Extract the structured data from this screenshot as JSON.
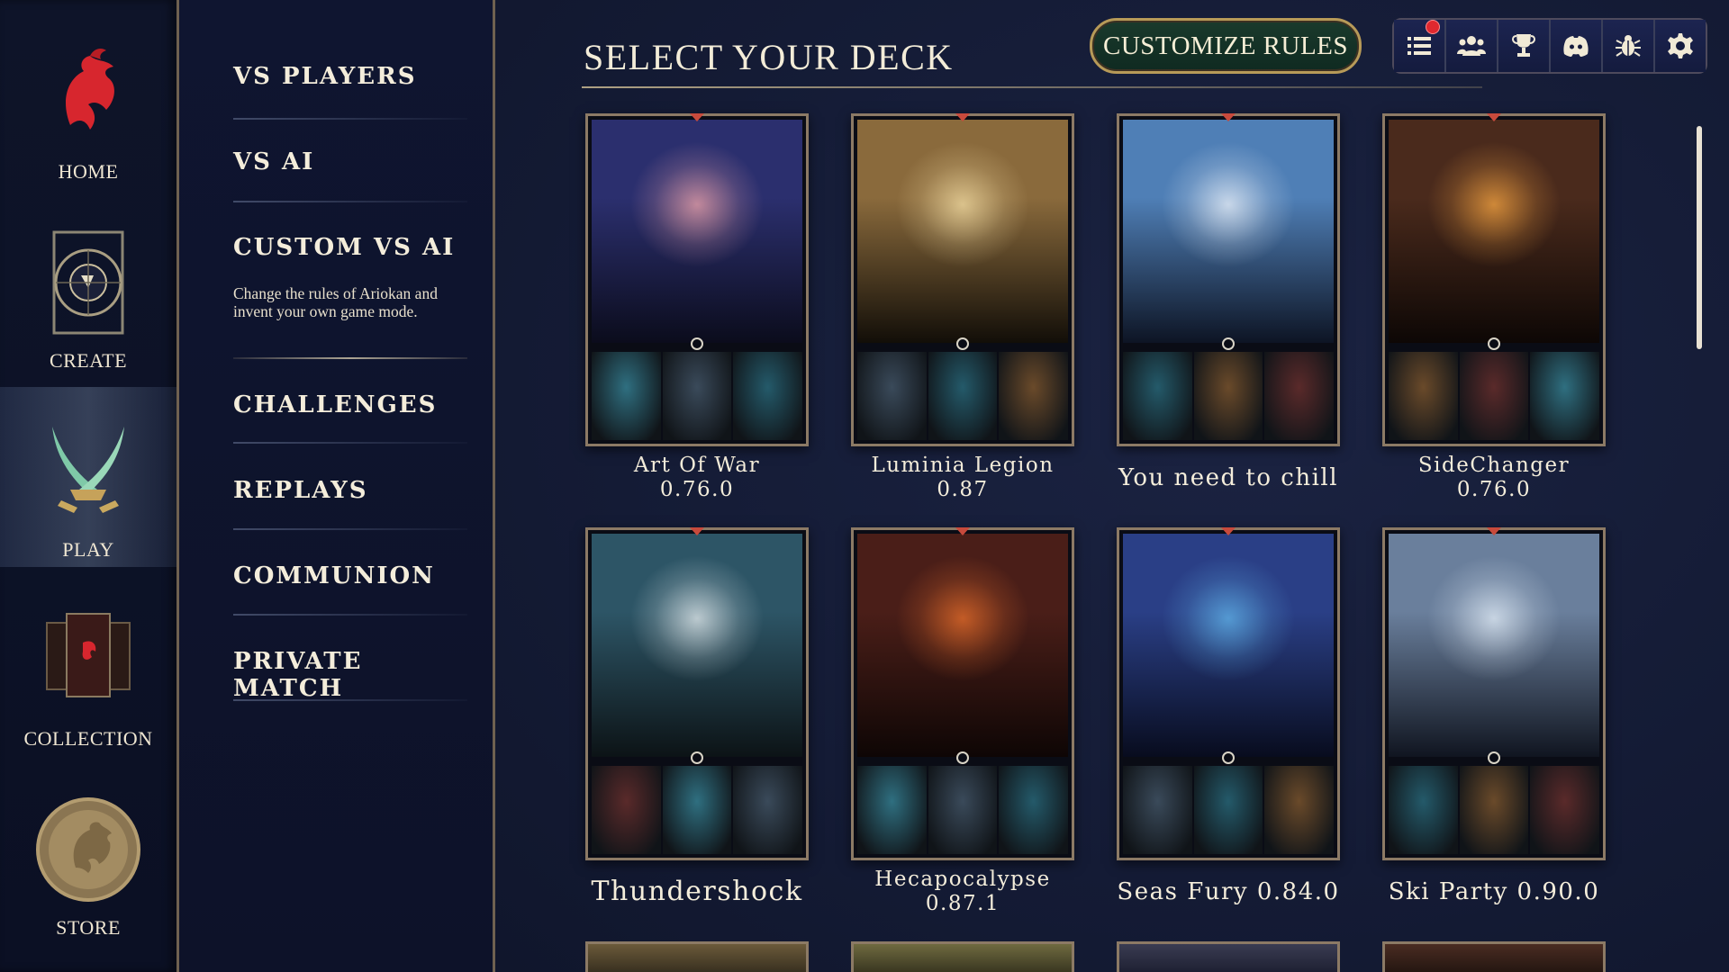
{
  "rail": {
    "items": [
      {
        "label": "HOME",
        "icon": "dragon-logo-icon"
      },
      {
        "label": "CREATE",
        "icon": "rune-circle-icon"
      },
      {
        "label": "PLAY",
        "icon": "crossed-blades-icon",
        "active": true
      },
      {
        "label": "COLLECTION",
        "icon": "card-fan-icon"
      },
      {
        "label": "STORE",
        "icon": "gold-coin-icon"
      }
    ]
  },
  "submenu": {
    "items": [
      {
        "label": "VS PLAYERS"
      },
      {
        "label": "VS AI"
      },
      {
        "label": "CUSTOM VS AI",
        "description": "Change the rules of Ariokan and invent your own game mode."
      },
      {
        "label": "CHALLENGES"
      },
      {
        "label": "REPLAYS"
      },
      {
        "label": "COMMUNION"
      },
      {
        "label": "PRIVATE MATCH"
      }
    ]
  },
  "header": {
    "title": "SELECT YOUR DECK",
    "customize_label": "CUSTOMIZE RULES"
  },
  "toolbar": {
    "buttons": [
      "list-icon",
      "friends-icon",
      "trophy-icon",
      "discord-icon",
      "bug-icon",
      "settings-icon"
    ],
    "notification_on": "list-icon"
  },
  "decks": [
    {
      "name": "Art Of War",
      "version": "0.76.0",
      "art": "raven-queen",
      "colors": {
        "top": "#2b2f6e",
        "bottom": "#0b0c1c",
        "accent": "#e8a0a8"
      }
    },
    {
      "name": "Luminia Legion",
      "version": "0.87",
      "art": "golden-angel",
      "colors": {
        "top": "#8a6a3c",
        "bottom": "#120e08",
        "accent": "#f0d9a0"
      }
    },
    {
      "name": "You need to chill",
      "version": "",
      "art": "cloud-giant",
      "colors": {
        "top": "#4f7fb6",
        "bottom": "#0d1424",
        "accent": "#e7eef7"
      }
    },
    {
      "name": "SideChanger",
      "version": "0.76.0",
      "art": "fire-sorceress",
      "colors": {
        "top": "#4a2a1c",
        "bottom": "#0d0705",
        "accent": "#f0a040"
      }
    },
    {
      "name": "Thundershock",
      "version": "",
      "art": "storm-god",
      "colors": {
        "top": "#2d5566",
        "bottom": "#0c1316",
        "accent": "#dfe7ea"
      }
    },
    {
      "name": "Hecapocalypse",
      "version": "0.87.1",
      "art": "dark-goddess",
      "colors": {
        "top": "#4a1e18",
        "bottom": "#0e0605",
        "accent": "#e26b2a"
      }
    },
    {
      "name": "Seas Fury 0.84.0",
      "version": "",
      "art": "sea-titan",
      "colors": {
        "top": "#2a3f86",
        "bottom": "#080c1e",
        "accent": "#5fb0e6"
      }
    },
    {
      "name": "Ski Party 0.90.0",
      "version": "",
      "art": "ice-queen",
      "colors": {
        "top": "#6a7f9c",
        "bottom": "#101520",
        "accent": "#dfeaf5"
      }
    }
  ]
}
